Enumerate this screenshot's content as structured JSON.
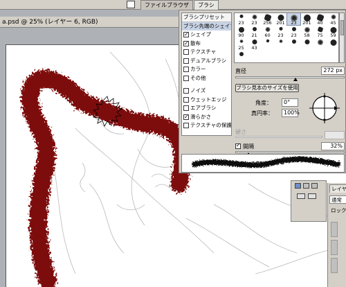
{
  "panel_tabs": [
    "ファイルブラウザ",
    "ブラシ"
  ],
  "document": {
    "title": "a.psd @ 25% (レイヤー 6, RGB)"
  },
  "brush_panel": {
    "sidebar_header": "ブラシプリセット",
    "sidebar_items": [
      {
        "label": "ブラシ先端のシェイプ",
        "checkbox": false,
        "checked": false,
        "selected": true
      },
      {
        "label": "シェイプ",
        "checkbox": true,
        "checked": true
      },
      {
        "label": "散布",
        "checkbox": true,
        "checked": true
      },
      {
        "label": "テクスチャ",
        "checkbox": true,
        "checked": false
      },
      {
        "label": "デュアルブラシ",
        "checkbox": true,
        "checked": false
      },
      {
        "label": "カラー",
        "checkbox": true,
        "checked": false
      },
      {
        "label": "その他",
        "checkbox": true,
        "checked": false
      },
      {
        "label": "ノイズ",
        "checkbox": true,
        "checked": false
      },
      {
        "label": "ウェットエッジ",
        "checkbox": true,
        "checked": false
      },
      {
        "label": "エアブラシ",
        "checkbox": true,
        "checked": false
      },
      {
        "label": "滑らかさ",
        "checkbox": true,
        "checked": true
      },
      {
        "label": "テクスチャの保護",
        "checkbox": true,
        "checked": false
      }
    ],
    "presets": [
      "23",
      "23",
      "256",
      "201",
      "23",
      "201",
      "40",
      "45",
      "90",
      "21",
      "60",
      "23",
      "23",
      "58",
      "75",
      "59",
      "25",
      "43",
      "",
      "",
      "",
      "",
      "",
      "",
      ""
    ],
    "diameter_label": "直径",
    "diameter_value": "272 px",
    "diameter_fraction": 0.55,
    "use_sample_size_label": "ブラシ見本のサイズを使用",
    "angle_label": "角度：",
    "angle_value": "0°",
    "roundness_label": "真円率：",
    "roundness_value": "100%",
    "hardness_label": "硬さ",
    "spacing_label": "間隔",
    "spacing_checked": true,
    "spacing_value": "32%",
    "spacing_fraction": 0.12
  },
  "layers_panel": {
    "tab_label": "レイヤー",
    "blend_mode": "通常",
    "lock_label": "ロック"
  },
  "colors": {
    "stroke_red": "#7d0b0b",
    "panel_bg": "#d4d0c8",
    "workspace_bg": "#aeb2b6"
  }
}
